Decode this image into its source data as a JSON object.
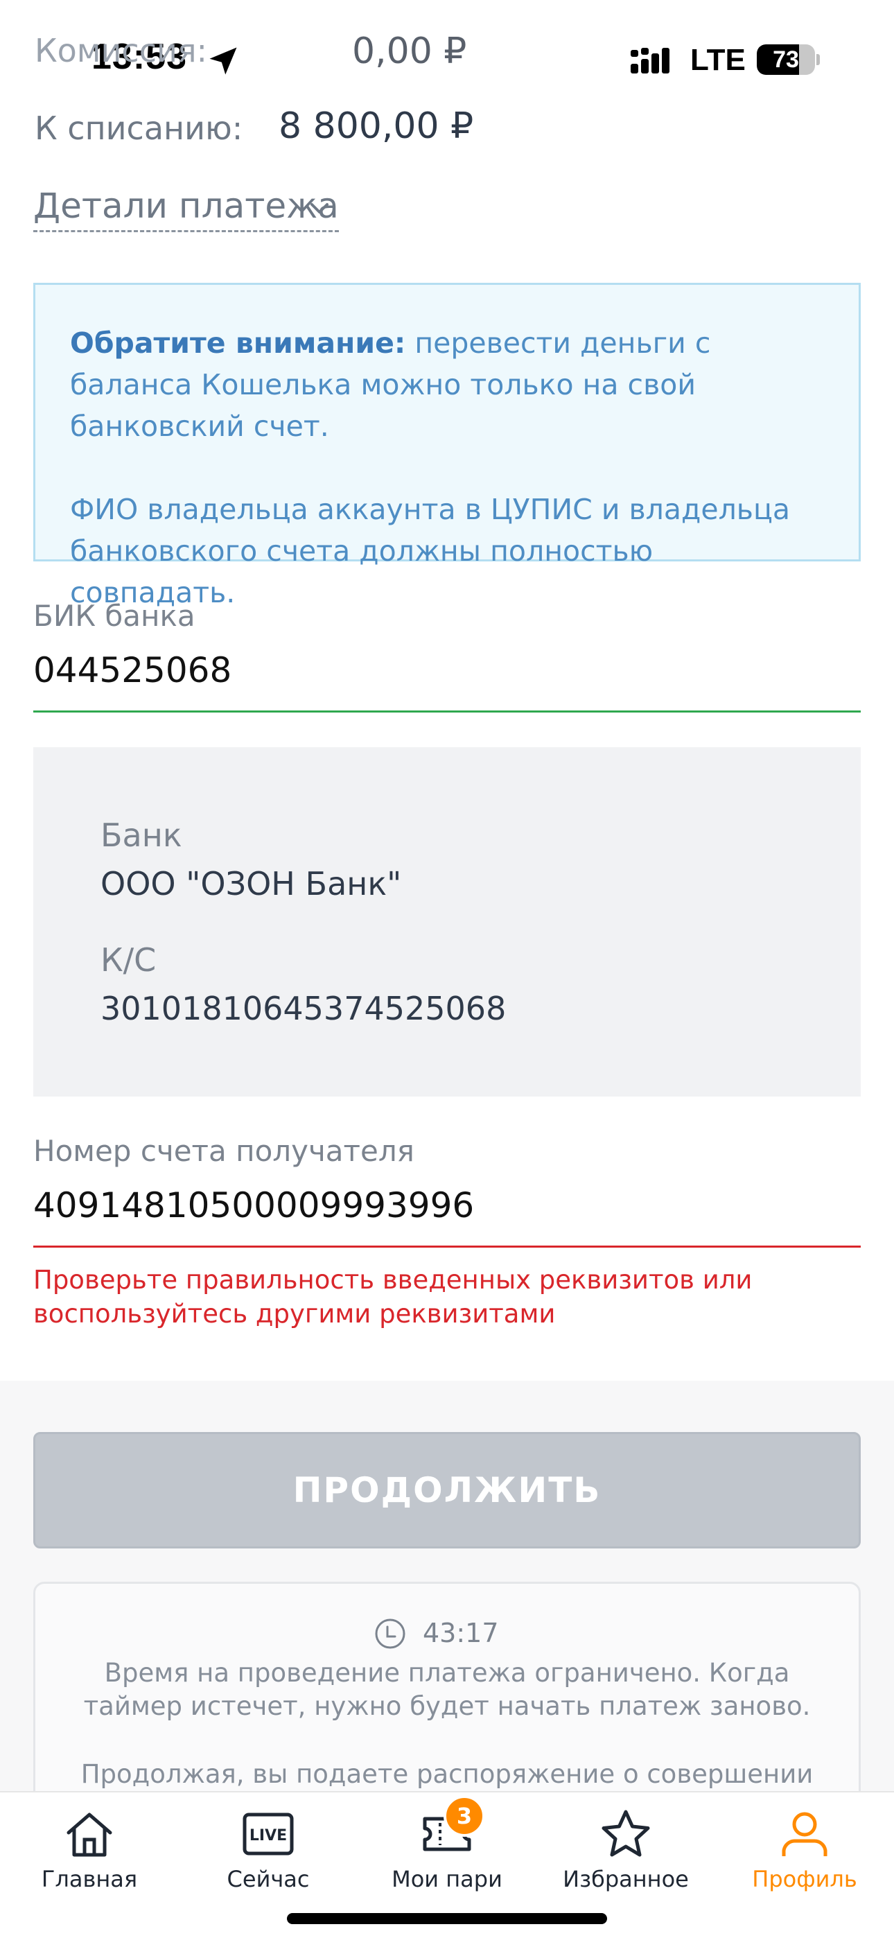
{
  "status_bar": {
    "time": "13:53",
    "network": "LTE",
    "battery": "73",
    "battery_level": 0.73
  },
  "summary": {
    "fee_label": "Комиссия:",
    "fee_value": "0,00 ₽",
    "debit_label": "К списанию:",
    "debit_value": "8 800,00 ₽",
    "details_link": "Детали платежа"
  },
  "notice": {
    "bold_prefix": "Обратите внимание:",
    "text1": " перевести деньги с баланса Кошелька можно только на свой банковский счет.",
    "text2": "ФИО владельца аккаунта в ЦУПИС и владельца банковского счета должны полностью совпадать."
  },
  "bik": {
    "label": "БИК банка",
    "value": "044525068"
  },
  "bank_info": {
    "bank_label": "Банк",
    "bank_value": "ООО \"ОЗОН Банк\"",
    "ks_label": "К/С",
    "ks_value": "30101810645374525068"
  },
  "account": {
    "label": "Номер счета получателя",
    "value": "40914810500009993996",
    "error": "Проверьте правильность введенных реквизитов или воспользуйтесь другими реквизитами"
  },
  "continue_button": "ПРОДОЛЖИТЬ",
  "info": {
    "timer": "43:17",
    "text1": "Время на проведение платежа ограничено. Когда таймер истечет, нужно будет начать платеж заново.",
    "text2": "Продолжая, вы подаете распоряжение о совершении"
  },
  "tabbar": {
    "home": "Главная",
    "live_icon_text": "LIVE",
    "now": "Сейчас",
    "bets": "Мои пари",
    "bets_badge": "3",
    "favorites": "Избранное",
    "profile": "Профиль"
  },
  "colors": {
    "accent": "#ff8a00",
    "success": "#2fa84f",
    "error": "#d9262b",
    "info": "#4e8dc4"
  }
}
